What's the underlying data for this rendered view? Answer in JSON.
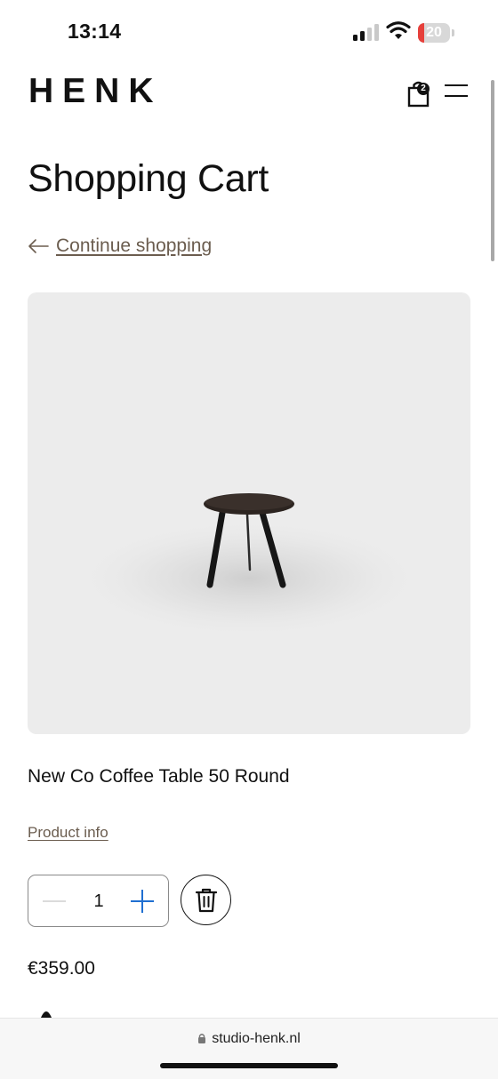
{
  "status_bar": {
    "time": "13:14",
    "battery_level": "20",
    "battery_fraction": 0.2
  },
  "header": {
    "logo": "HENK",
    "cart_count": "2"
  },
  "page": {
    "title": "Shopping Cart",
    "continue_shopping": "Continue shopping"
  },
  "cart_item": {
    "name": "New Co Coffee Table 50 Round",
    "product_info": "Product info",
    "quantity": "1",
    "price": "€359.00"
  },
  "browser": {
    "url": "studio-henk.nl"
  },
  "colors": {
    "accent_link": "#6b5d4f",
    "stepper_plus": "#1f6fd1",
    "battery_low": "#e6403b"
  },
  "icons": [
    "signal-icon",
    "wifi-icon",
    "battery-icon",
    "cart-icon",
    "menu-icon",
    "arrow-left-icon",
    "minus-icon",
    "plus-icon",
    "trash-icon",
    "lock-icon"
  ]
}
